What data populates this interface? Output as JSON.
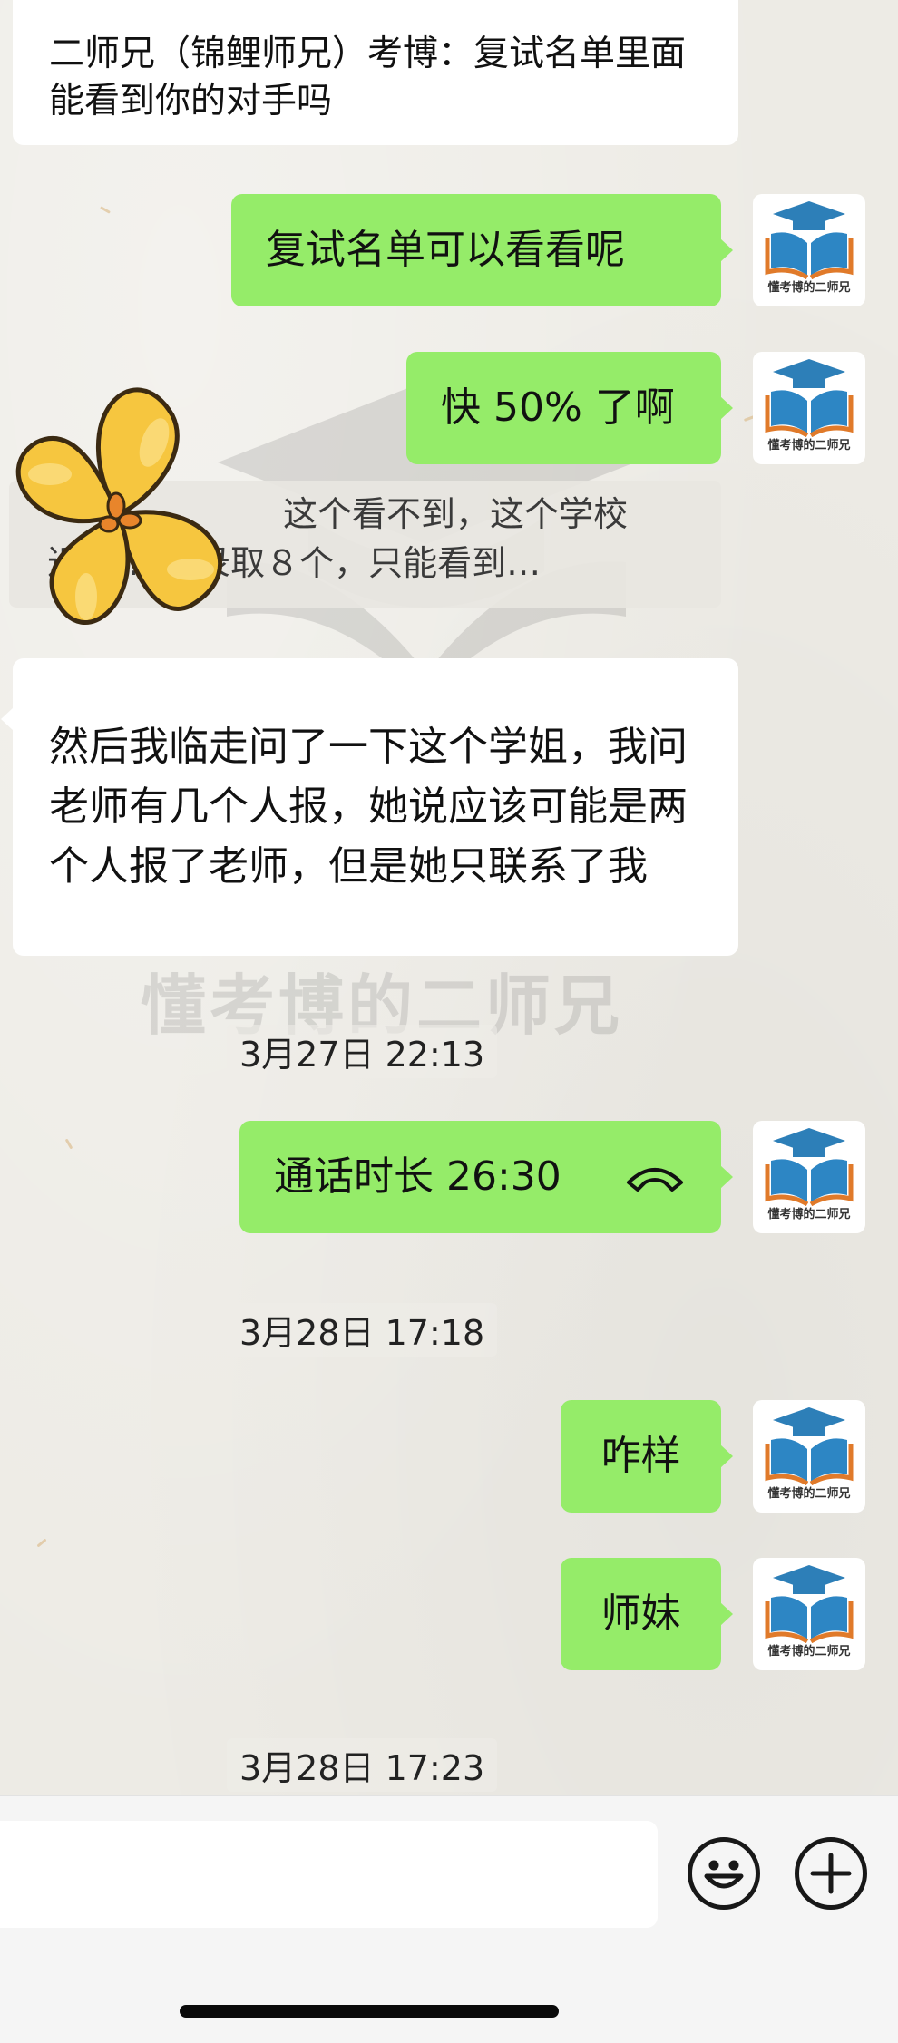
{
  "watermark": {
    "text": "懂考博的二师兄"
  },
  "avatar": {
    "caption": "懂考博的二师兄"
  },
  "messages": {
    "m0": "二师兄（锦鲤师兄）考博：复试名单里面能看到你的对手吗",
    "m1": "复试名单可以看看呢",
    "m2": "快 50% 了啊",
    "quote_line1": "这个看不到，这个学校",
    "quote_line2": "近多… ，录取８个，只能看到…",
    "m3": "然后我临走问了一下这个学姐，我问老师有几个人报，她说应该可能是两个人报了老师，但是她只联系了我",
    "m4": "通话时长 26:30",
    "m5": "咋样",
    "m6": "师妹"
  },
  "timestamps": {
    "t1": "3月27日 22:13",
    "t2": "3月28日 17:18",
    "t3": "3月28日 17:23"
  },
  "colors": {
    "sent_bubble": "#95ec69",
    "received_bubble": "#ffffff",
    "background": "#edebe5"
  },
  "icons": {
    "call": "phone-hangup-icon",
    "emoji": "smiley-icon",
    "more": "plus-circle-icon"
  }
}
